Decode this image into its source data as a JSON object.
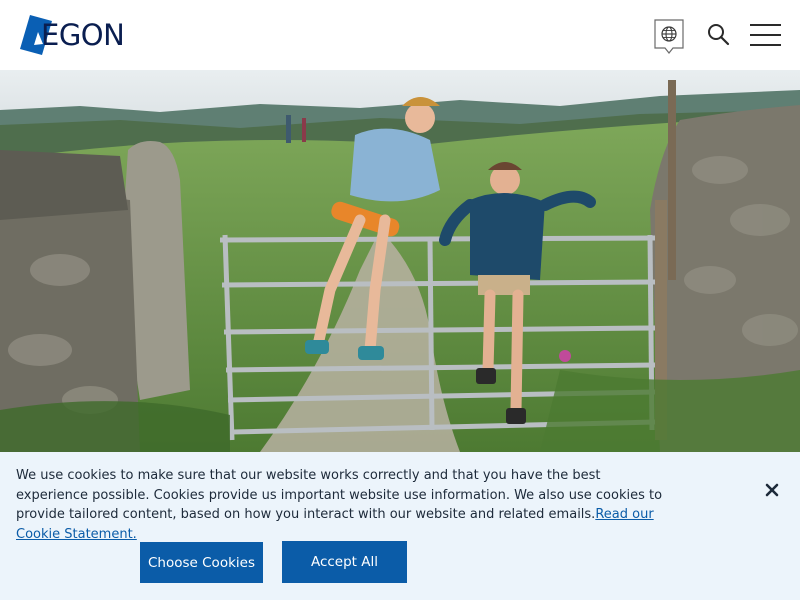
{
  "header": {
    "logo_text": "EGON",
    "logo_label": "AEGON",
    "icons": {
      "language": "globe-icon",
      "search": "search-icon",
      "menu": "hamburger-menu-icon"
    }
  },
  "hero": {
    "image_label": "hero-photo"
  },
  "cookie_banner": {
    "message": "We use cookies to make sure that our website works correctly and that you have the best experience possible. Cookies provide us important website use information. We also use cookies to provide tailored content, based on how you interact with our website and related emails.",
    "link_text": "Read our Cookie Statement.",
    "choose_label": "Choose Cookies",
    "accept_label": "Accept All",
    "close_icon": "close-icon"
  },
  "colors": {
    "brand_blue": "#0b5ca8",
    "logo_blue": "#0a5fb4",
    "banner_bg": "#ecf4fb",
    "text_dark": "#1d2a3a"
  }
}
